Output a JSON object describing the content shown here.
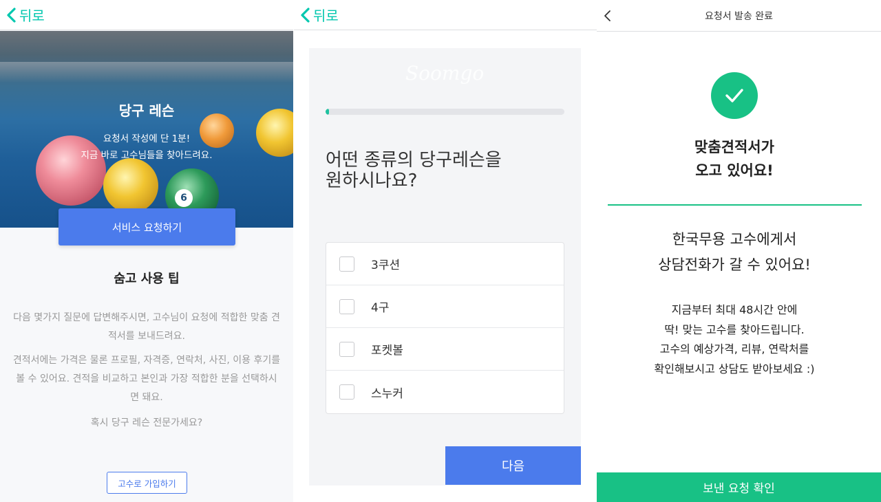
{
  "panel1": {
    "back_label": "뒤로",
    "hero_title": "당구 레슨",
    "hero_line1": "요청서 작성에 단 1분!",
    "hero_line2": "지금 바로 고수님들을 찾아드려요.",
    "ball_number": "6",
    "cta_label": "서비스 요청하기",
    "tips_title": "숨고 사용 팁",
    "tips_p1": "다음 몇가지 질문에 답변해주시면, 고수님이 요청에 적합한 맞춤 견적서를 보내드려요.",
    "tips_p2": "견적서에는 가격은 물론 프로필, 자격증, 연락처, 사진, 이용 후기를 볼 수 있어요. 견적을 비교하고 본인과 가장 적합한 분을 선택하시면 돼요.",
    "tips_p3": "혹시 당구 레슨 전문가세요?",
    "pro_button_label": "고수로 가입하기"
  },
  "panel2": {
    "back_label": "뒤로",
    "watermark": "Soomgo",
    "progress": 0.01,
    "question_line1": "어떤 종류의 당구레슨을",
    "question_line2": "원하시나요?",
    "options": [
      {
        "label": "3쿠션",
        "checked": false
      },
      {
        "label": "4구",
        "checked": false
      },
      {
        "label": "포켓볼",
        "checked": false
      },
      {
        "label": "스누커",
        "checked": false
      }
    ],
    "next_label": "다음"
  },
  "panel3": {
    "title": "요청서 발송 완료",
    "done_line1": "맞춤견적서가",
    "done_line2": "오고 있어요!",
    "notice_line1": "한국무용 고수에게서",
    "notice_line2": "상담전화가 갈 수 있어요!",
    "detail_line1": "지금부터 최대 48시간 안에",
    "detail_line2": "딱! 맞는 고수를 찾아드립니다.",
    "detail_line3": "고수의 예상가격, 리뷰, 연락처를",
    "detail_line4": "확인해보시고 상담도 받아보세요 :)",
    "confirm_label": "보낸 요청 확인"
  },
  "colors": {
    "brand_green": "#00c7ae",
    "primary_blue": "#4b7bec",
    "success_green": "#18c185"
  },
  "icons": {
    "back": "chevron-left-icon",
    "success": "check-icon"
  }
}
